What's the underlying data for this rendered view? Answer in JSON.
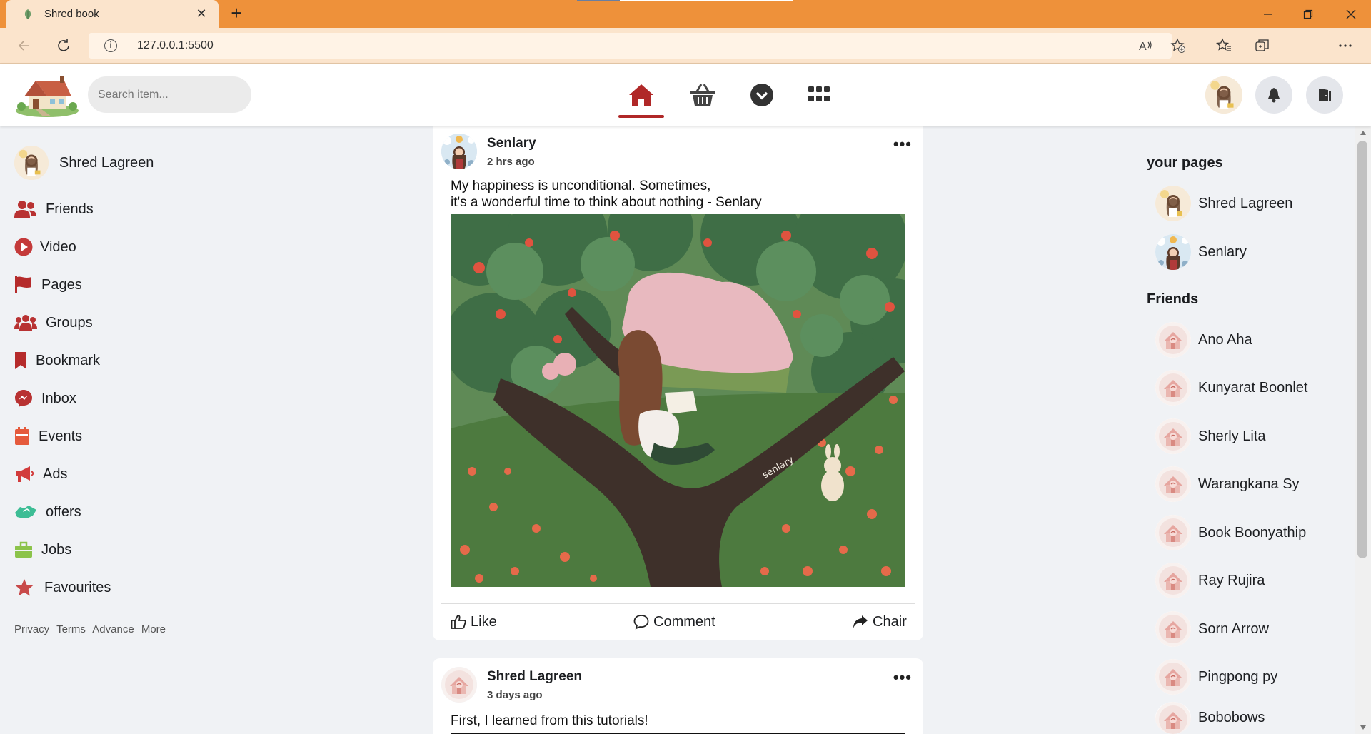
{
  "browser": {
    "tab_title": "Shred book",
    "url": "127.0.0.1:5500"
  },
  "header": {
    "search_placeholder": "Search item...",
    "nav": [
      "home-icon",
      "basket-icon",
      "chevron-circle-down-icon",
      "grid-icon"
    ],
    "active_nav": "home",
    "accent_color": "#b02828"
  },
  "sidebar": {
    "profile_name": "Shred Lagreen",
    "items": [
      {
        "label": "Friends",
        "icon": "friends-icon",
        "color": "#b83232"
      },
      {
        "label": "Video",
        "icon": "play-icon",
        "color": "#c43a3a"
      },
      {
        "label": "Pages",
        "icon": "flag-icon",
        "color": "#b52b2b"
      },
      {
        "label": "Groups",
        "icon": "groups-icon",
        "color": "#b83232"
      },
      {
        "label": "Bookmark",
        "icon": "bookmark-icon",
        "color": "#b52b2b"
      },
      {
        "label": "Inbox",
        "icon": "messenger-icon",
        "color": "#b83232"
      },
      {
        "label": "Events",
        "icon": "calendar-icon",
        "color": "#e55a3c"
      },
      {
        "label": "Ads",
        "icon": "megaphone-icon",
        "color": "#d23b3b"
      },
      {
        "label": "offers",
        "icon": "handshake-icon",
        "color": "#3dbd95"
      },
      {
        "label": "Jobs",
        "icon": "briefcase-icon",
        "color": "#8bc34a"
      },
      {
        "label": "Favourites",
        "icon": "star-icon",
        "color": "#c84a4a"
      }
    ],
    "footer_links": [
      "Privacy",
      "Terms",
      "Advance",
      "More"
    ]
  },
  "feed": {
    "posts": [
      {
        "author": "Senlary",
        "time": "2 hrs ago",
        "text_line1": "My happiness is unconditional. Sometimes,",
        "text_line2": "it's a wonderful time to think about nothing - Senlary",
        "image_signature": "senlary",
        "actions": {
          "like": "Like",
          "comment": "Comment",
          "share": "Chair"
        }
      },
      {
        "author": "Shred Lagreen",
        "time": "3 days ago",
        "text_line1": "First, I learned from this tutorials!"
      }
    ]
  },
  "right_sidebar": {
    "pages_title": "your pages",
    "pages": [
      "Shred Lagreen",
      "Senlary"
    ],
    "friends_title": "Friends",
    "friends": [
      "Ano Aha",
      "Kunyarat Boonlet",
      "Sherly Lita",
      "Warangkana Sy",
      "Book Boonyathip",
      "Ray Rujira",
      "Sorn Arrow",
      "Pingpong py",
      "Bobobows"
    ]
  }
}
